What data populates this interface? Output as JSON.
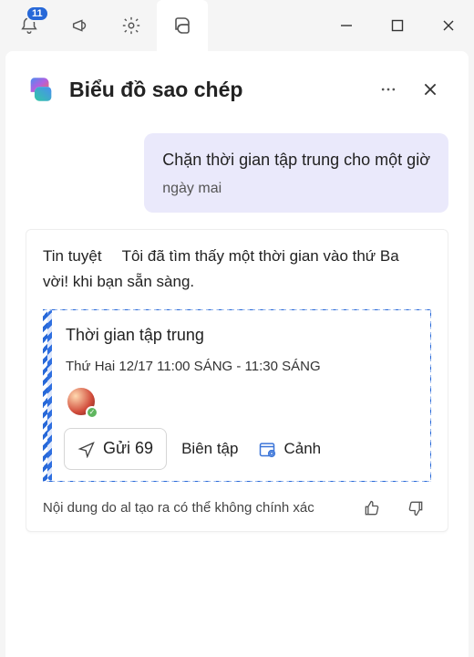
{
  "titlebar": {
    "notification_badge": "11"
  },
  "panel": {
    "title": "Biểu đồ sao chép"
  },
  "user_message": {
    "line1": "Chặn thời gian tập trung cho một giờ",
    "line2": "ngày mai"
  },
  "assistant_message": {
    "cell_left_top": "Tin tuyệt",
    "cell_right": "Tôi đã tìm thấy một thời gian vào thứ Ba",
    "cell_left_bottom": "vời! khi bạn sẵn sàng."
  },
  "event": {
    "title": "Thời gian tập trung",
    "time": "Thứ Hai 12/17 11:00 SÁNG - 11:30 SÁNG",
    "send_label": "Gửi 69",
    "edit_label": "Biên tập",
    "view_label": "Cảnh"
  },
  "footer": {
    "disclaimer": "Nội dung do al tạo ra có thể không chính xác"
  }
}
